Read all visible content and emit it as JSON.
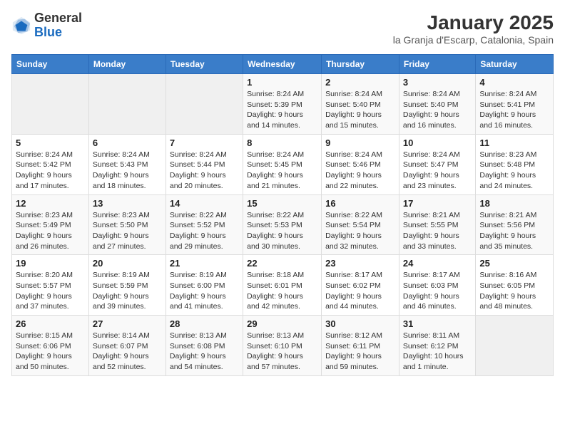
{
  "header": {
    "logo_general": "General",
    "logo_blue": "Blue",
    "title": "January 2025",
    "subtitle": "la Granja d'Escarp, Catalonia, Spain"
  },
  "calendar": {
    "weekdays": [
      "Sunday",
      "Monday",
      "Tuesday",
      "Wednesday",
      "Thursday",
      "Friday",
      "Saturday"
    ],
    "weeks": [
      [
        {
          "day": "",
          "info": ""
        },
        {
          "day": "",
          "info": ""
        },
        {
          "day": "",
          "info": ""
        },
        {
          "day": "1",
          "info": "Sunrise: 8:24 AM\nSunset: 5:39 PM\nDaylight: 9 hours\nand 14 minutes."
        },
        {
          "day": "2",
          "info": "Sunrise: 8:24 AM\nSunset: 5:40 PM\nDaylight: 9 hours\nand 15 minutes."
        },
        {
          "day": "3",
          "info": "Sunrise: 8:24 AM\nSunset: 5:40 PM\nDaylight: 9 hours\nand 16 minutes."
        },
        {
          "day": "4",
          "info": "Sunrise: 8:24 AM\nSunset: 5:41 PM\nDaylight: 9 hours\nand 16 minutes."
        }
      ],
      [
        {
          "day": "5",
          "info": "Sunrise: 8:24 AM\nSunset: 5:42 PM\nDaylight: 9 hours\nand 17 minutes."
        },
        {
          "day": "6",
          "info": "Sunrise: 8:24 AM\nSunset: 5:43 PM\nDaylight: 9 hours\nand 18 minutes."
        },
        {
          "day": "7",
          "info": "Sunrise: 8:24 AM\nSunset: 5:44 PM\nDaylight: 9 hours\nand 20 minutes."
        },
        {
          "day": "8",
          "info": "Sunrise: 8:24 AM\nSunset: 5:45 PM\nDaylight: 9 hours\nand 21 minutes."
        },
        {
          "day": "9",
          "info": "Sunrise: 8:24 AM\nSunset: 5:46 PM\nDaylight: 9 hours\nand 22 minutes."
        },
        {
          "day": "10",
          "info": "Sunrise: 8:24 AM\nSunset: 5:47 PM\nDaylight: 9 hours\nand 23 minutes."
        },
        {
          "day": "11",
          "info": "Sunrise: 8:23 AM\nSunset: 5:48 PM\nDaylight: 9 hours\nand 24 minutes."
        }
      ],
      [
        {
          "day": "12",
          "info": "Sunrise: 8:23 AM\nSunset: 5:49 PM\nDaylight: 9 hours\nand 26 minutes."
        },
        {
          "day": "13",
          "info": "Sunrise: 8:23 AM\nSunset: 5:50 PM\nDaylight: 9 hours\nand 27 minutes."
        },
        {
          "day": "14",
          "info": "Sunrise: 8:22 AM\nSunset: 5:52 PM\nDaylight: 9 hours\nand 29 minutes."
        },
        {
          "day": "15",
          "info": "Sunrise: 8:22 AM\nSunset: 5:53 PM\nDaylight: 9 hours\nand 30 minutes."
        },
        {
          "day": "16",
          "info": "Sunrise: 8:22 AM\nSunset: 5:54 PM\nDaylight: 9 hours\nand 32 minutes."
        },
        {
          "day": "17",
          "info": "Sunrise: 8:21 AM\nSunset: 5:55 PM\nDaylight: 9 hours\nand 33 minutes."
        },
        {
          "day": "18",
          "info": "Sunrise: 8:21 AM\nSunset: 5:56 PM\nDaylight: 9 hours\nand 35 minutes."
        }
      ],
      [
        {
          "day": "19",
          "info": "Sunrise: 8:20 AM\nSunset: 5:57 PM\nDaylight: 9 hours\nand 37 minutes."
        },
        {
          "day": "20",
          "info": "Sunrise: 8:19 AM\nSunset: 5:59 PM\nDaylight: 9 hours\nand 39 minutes."
        },
        {
          "day": "21",
          "info": "Sunrise: 8:19 AM\nSunset: 6:00 PM\nDaylight: 9 hours\nand 41 minutes."
        },
        {
          "day": "22",
          "info": "Sunrise: 8:18 AM\nSunset: 6:01 PM\nDaylight: 9 hours\nand 42 minutes."
        },
        {
          "day": "23",
          "info": "Sunrise: 8:17 AM\nSunset: 6:02 PM\nDaylight: 9 hours\nand 44 minutes."
        },
        {
          "day": "24",
          "info": "Sunrise: 8:17 AM\nSunset: 6:03 PM\nDaylight: 9 hours\nand 46 minutes."
        },
        {
          "day": "25",
          "info": "Sunrise: 8:16 AM\nSunset: 6:05 PM\nDaylight: 9 hours\nand 48 minutes."
        }
      ],
      [
        {
          "day": "26",
          "info": "Sunrise: 8:15 AM\nSunset: 6:06 PM\nDaylight: 9 hours\nand 50 minutes."
        },
        {
          "day": "27",
          "info": "Sunrise: 8:14 AM\nSunset: 6:07 PM\nDaylight: 9 hours\nand 52 minutes."
        },
        {
          "day": "28",
          "info": "Sunrise: 8:13 AM\nSunset: 6:08 PM\nDaylight: 9 hours\nand 54 minutes."
        },
        {
          "day": "29",
          "info": "Sunrise: 8:13 AM\nSunset: 6:10 PM\nDaylight: 9 hours\nand 57 minutes."
        },
        {
          "day": "30",
          "info": "Sunrise: 8:12 AM\nSunset: 6:11 PM\nDaylight: 9 hours\nand 59 minutes."
        },
        {
          "day": "31",
          "info": "Sunrise: 8:11 AM\nSunset: 6:12 PM\nDaylight: 10 hours\nand 1 minute."
        },
        {
          "day": "",
          "info": ""
        }
      ]
    ]
  }
}
